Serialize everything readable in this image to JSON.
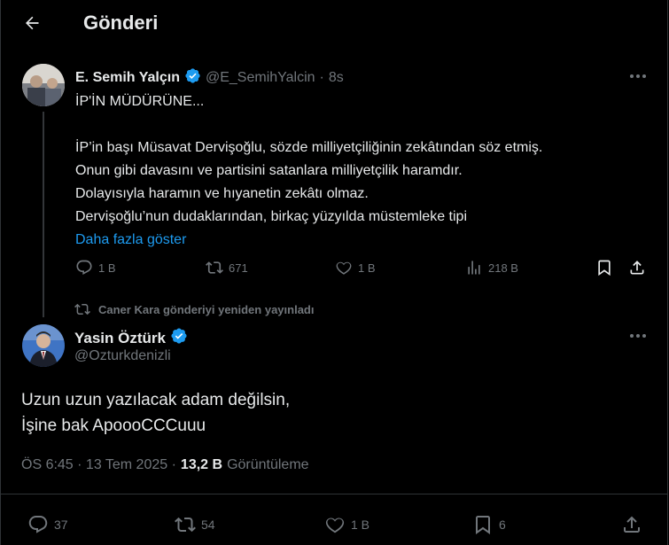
{
  "header": {
    "title": "Gönderi"
  },
  "quoted": {
    "name": "E. Semih Yalçın",
    "handle": "@E_SemihYalcin",
    "sep": "·",
    "time": "8s",
    "lines": [
      "İP'İN MÜDÜRÜNE...",
      "",
      "İP’in başı Müsavat Dervişoğlu, sözde milliyetçiliğinin zekâtından söz etmiş.",
      "Onun gibi davasını ve partisini satanlara milliyetçilik haramdır.",
      "Dolayısıyla haramın ve hıyanetin zekâtı olmaz.",
      "Dervişoğlu’nun dudaklarından, birkaç yüzyılda müstemleke tipi"
    ],
    "show_more": "Daha fazla göster",
    "actions": {
      "reply": "1 B",
      "repost": "671",
      "like": "1 B",
      "views": "218 B"
    }
  },
  "repost_note": "Caner Kara gönderiyi yeniden yayınladı",
  "main": {
    "name": "Yasin Öztürk",
    "handle": "@Ozturkdenizli",
    "line1": "Uzun uzun yazılacak adam değilsin,",
    "line2": "İşine bak ApoooCCCuuu",
    "time": "ÖS 6:45 · 13 Tem 2025 ·",
    "views_count": "13,2 B",
    "views_label": "Görüntüleme",
    "actions": {
      "reply": "37",
      "repost": "54",
      "like": "1 B",
      "bookmark": "6"
    }
  },
  "colors": {
    "accent": "#1d9bf0",
    "verified": "#1d9bf0",
    "muted": "#71767b",
    "text": "#e7e9ea"
  }
}
